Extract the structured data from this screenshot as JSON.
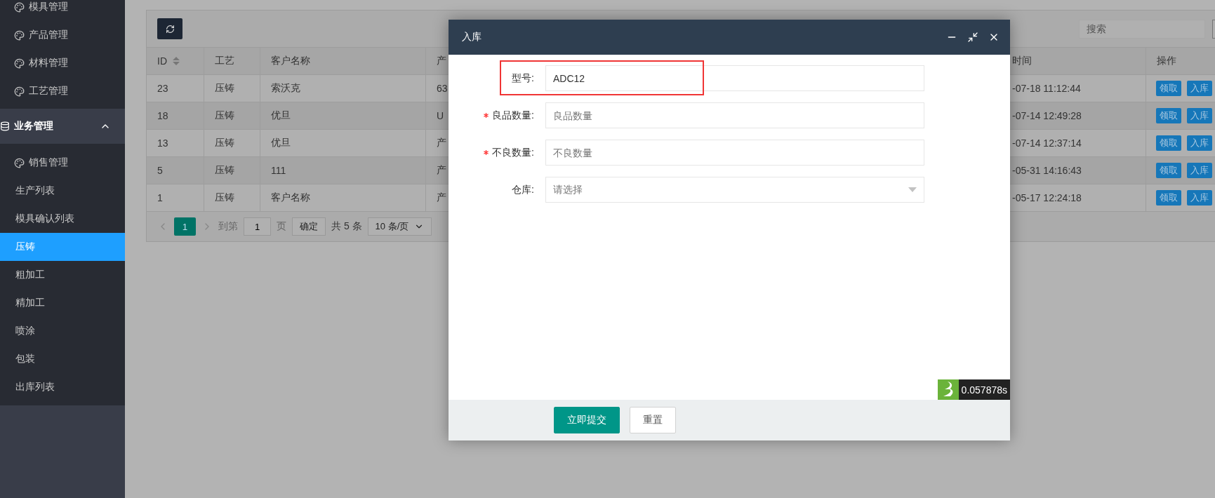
{
  "sidebar": {
    "top_items": [
      {
        "label": "模具管理"
      },
      {
        "label": "产品管理"
      },
      {
        "label": "材料管理"
      },
      {
        "label": "工艺管理"
      }
    ],
    "group": {
      "label": "业务管理",
      "expanded": true,
      "children": [
        {
          "label": "销售管理",
          "kind": "module",
          "selected": false
        },
        {
          "label": "生产列表",
          "kind": "page",
          "selected": false
        },
        {
          "label": "模具确认列表",
          "kind": "page",
          "selected": false
        },
        {
          "label": "压铸",
          "kind": "page",
          "selected": true
        },
        {
          "label": "粗加工",
          "kind": "page",
          "selected": false
        },
        {
          "label": "精加工",
          "kind": "page",
          "selected": false
        },
        {
          "label": "喷涂",
          "kind": "page",
          "selected": false
        },
        {
          "label": "包装",
          "kind": "page",
          "selected": false
        },
        {
          "label": "出库列表",
          "kind": "page",
          "selected": false
        }
      ]
    }
  },
  "toolbar": {
    "search": {
      "placeholder": "搜索"
    }
  },
  "table": {
    "columns": [
      {
        "label": "ID",
        "sortable": true
      },
      {
        "label": "工艺",
        "sortable": false
      },
      {
        "label": "客户名称",
        "sortable": false
      },
      {
        "label": "产"
      },
      {
        "label": "时间",
        "sortable": false
      },
      {
        "label": "操作",
        "sortable": false
      }
    ],
    "rows": [
      {
        "cells": [
          "23",
          "压铸",
          "索沃克",
          "63",
          "-07-18 11:12:44"
        ],
        "actions": [
          "领取",
          "入库"
        ]
      },
      {
        "cells": [
          "18",
          "压铸",
          "优旦",
          "U",
          "-07-14 12:49:28"
        ],
        "actions": [
          "领取",
          "入库"
        ]
      },
      {
        "cells": [
          "13",
          "压铸",
          "优旦",
          "产",
          "-07-14 12:37:14"
        ],
        "actions": [
          "领取",
          "入库"
        ]
      },
      {
        "cells": [
          "5",
          "压铸",
          "111",
          "产",
          "-05-31 14:16:43"
        ],
        "actions": [
          "领取",
          "入库"
        ]
      },
      {
        "cells": [
          "1",
          "压铸",
          "客户名称",
          "产",
          "-05-17 12:24:18"
        ],
        "actions": [
          "领取",
          "入库"
        ]
      }
    ]
  },
  "pagination": {
    "current": "1",
    "goto_label": "到第",
    "goto_value": "1",
    "page_unit": "页",
    "confirm": "确定",
    "total": "共 5 条",
    "page_size": "10 条/页"
  },
  "modal": {
    "title": "入库",
    "fields": [
      {
        "label": "型号:",
        "required": false,
        "kind": "text",
        "value": "ADC12",
        "highlighted": true
      },
      {
        "label": "良品数量:",
        "required": true,
        "kind": "text",
        "placeholder": "良品数量",
        "highlighted": false
      },
      {
        "label": "不良数量:",
        "required": true,
        "kind": "text",
        "placeholder": "不良数量",
        "highlighted": false
      },
      {
        "label": "仓库:",
        "required": false,
        "kind": "select",
        "placeholder": "请选择",
        "highlighted": false
      }
    ],
    "buttons": [
      {
        "label": "立即提交",
        "kind": "primary"
      },
      {
        "label": "重置",
        "kind": "default"
      }
    ],
    "timer": "0.057878s"
  }
}
